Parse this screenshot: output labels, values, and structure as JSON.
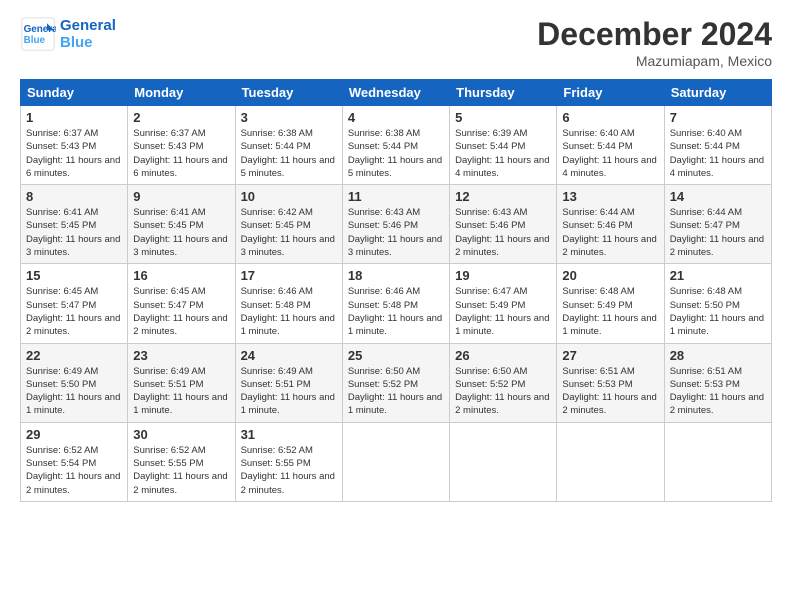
{
  "header": {
    "logo_line1": "General",
    "logo_line2": "Blue",
    "month": "December 2024",
    "location": "Mazumiapam, Mexico"
  },
  "days_of_week": [
    "Sunday",
    "Monday",
    "Tuesday",
    "Wednesday",
    "Thursday",
    "Friday",
    "Saturday"
  ],
  "weeks": [
    [
      {
        "day": "1",
        "info": "Sunrise: 6:37 AM\nSunset: 5:43 PM\nDaylight: 11 hours and 6 minutes."
      },
      {
        "day": "2",
        "info": "Sunrise: 6:37 AM\nSunset: 5:43 PM\nDaylight: 11 hours and 6 minutes."
      },
      {
        "day": "3",
        "info": "Sunrise: 6:38 AM\nSunset: 5:44 PM\nDaylight: 11 hours and 5 minutes."
      },
      {
        "day": "4",
        "info": "Sunrise: 6:38 AM\nSunset: 5:44 PM\nDaylight: 11 hours and 5 minutes."
      },
      {
        "day": "5",
        "info": "Sunrise: 6:39 AM\nSunset: 5:44 PM\nDaylight: 11 hours and 4 minutes."
      },
      {
        "day": "6",
        "info": "Sunrise: 6:40 AM\nSunset: 5:44 PM\nDaylight: 11 hours and 4 minutes."
      },
      {
        "day": "7",
        "info": "Sunrise: 6:40 AM\nSunset: 5:44 PM\nDaylight: 11 hours and 4 minutes."
      }
    ],
    [
      {
        "day": "8",
        "info": "Sunrise: 6:41 AM\nSunset: 5:45 PM\nDaylight: 11 hours and 3 minutes."
      },
      {
        "day": "9",
        "info": "Sunrise: 6:41 AM\nSunset: 5:45 PM\nDaylight: 11 hours and 3 minutes."
      },
      {
        "day": "10",
        "info": "Sunrise: 6:42 AM\nSunset: 5:45 PM\nDaylight: 11 hours and 3 minutes."
      },
      {
        "day": "11",
        "info": "Sunrise: 6:43 AM\nSunset: 5:46 PM\nDaylight: 11 hours and 3 minutes."
      },
      {
        "day": "12",
        "info": "Sunrise: 6:43 AM\nSunset: 5:46 PM\nDaylight: 11 hours and 2 minutes."
      },
      {
        "day": "13",
        "info": "Sunrise: 6:44 AM\nSunset: 5:46 PM\nDaylight: 11 hours and 2 minutes."
      },
      {
        "day": "14",
        "info": "Sunrise: 6:44 AM\nSunset: 5:47 PM\nDaylight: 11 hours and 2 minutes."
      }
    ],
    [
      {
        "day": "15",
        "info": "Sunrise: 6:45 AM\nSunset: 5:47 PM\nDaylight: 11 hours and 2 minutes."
      },
      {
        "day": "16",
        "info": "Sunrise: 6:45 AM\nSunset: 5:47 PM\nDaylight: 11 hours and 2 minutes."
      },
      {
        "day": "17",
        "info": "Sunrise: 6:46 AM\nSunset: 5:48 PM\nDaylight: 11 hours and 1 minute."
      },
      {
        "day": "18",
        "info": "Sunrise: 6:46 AM\nSunset: 5:48 PM\nDaylight: 11 hours and 1 minute."
      },
      {
        "day": "19",
        "info": "Sunrise: 6:47 AM\nSunset: 5:49 PM\nDaylight: 11 hours and 1 minute."
      },
      {
        "day": "20",
        "info": "Sunrise: 6:48 AM\nSunset: 5:49 PM\nDaylight: 11 hours and 1 minute."
      },
      {
        "day": "21",
        "info": "Sunrise: 6:48 AM\nSunset: 5:50 PM\nDaylight: 11 hours and 1 minute."
      }
    ],
    [
      {
        "day": "22",
        "info": "Sunrise: 6:49 AM\nSunset: 5:50 PM\nDaylight: 11 hours and 1 minute."
      },
      {
        "day": "23",
        "info": "Sunrise: 6:49 AM\nSunset: 5:51 PM\nDaylight: 11 hours and 1 minute."
      },
      {
        "day": "24",
        "info": "Sunrise: 6:49 AM\nSunset: 5:51 PM\nDaylight: 11 hours and 1 minute."
      },
      {
        "day": "25",
        "info": "Sunrise: 6:50 AM\nSunset: 5:52 PM\nDaylight: 11 hours and 1 minute."
      },
      {
        "day": "26",
        "info": "Sunrise: 6:50 AM\nSunset: 5:52 PM\nDaylight: 11 hours and 2 minutes."
      },
      {
        "day": "27",
        "info": "Sunrise: 6:51 AM\nSunset: 5:53 PM\nDaylight: 11 hours and 2 minutes."
      },
      {
        "day": "28",
        "info": "Sunrise: 6:51 AM\nSunset: 5:53 PM\nDaylight: 11 hours and 2 minutes."
      }
    ],
    [
      {
        "day": "29",
        "info": "Sunrise: 6:52 AM\nSunset: 5:54 PM\nDaylight: 11 hours and 2 minutes."
      },
      {
        "day": "30",
        "info": "Sunrise: 6:52 AM\nSunset: 5:55 PM\nDaylight: 11 hours and 2 minutes."
      },
      {
        "day": "31",
        "info": "Sunrise: 6:52 AM\nSunset: 5:55 PM\nDaylight: 11 hours and 2 minutes."
      },
      {
        "day": "",
        "info": ""
      },
      {
        "day": "",
        "info": ""
      },
      {
        "day": "",
        "info": ""
      },
      {
        "day": "",
        "info": ""
      }
    ]
  ]
}
